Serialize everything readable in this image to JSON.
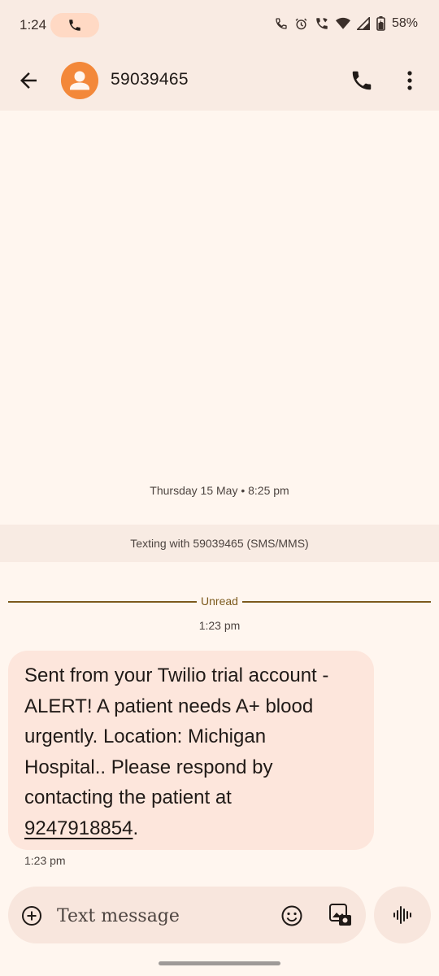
{
  "status_bar": {
    "time": "1:24",
    "battery": "58%"
  },
  "header": {
    "contact_name": "59039465"
  },
  "conversation": {
    "date_header": "Thursday 15 May • 8:25 pm",
    "texting_banner": "Texting with 59039465 (SMS/MMS)",
    "unread_label": "Unread",
    "message_time_top": "1:23 pm",
    "message": {
      "line1": "Sent from your Twilio trial account -",
      "line2": "ALERT! A patient needs A+ blood",
      "line3": "urgently. Location: Michigan",
      "line4": "Hospital.. Please respond by",
      "line5": "contacting the patient at",
      "phone_link": "9247918854",
      "trailing": "."
    },
    "message_time_bottom": "1:23 pm"
  },
  "compose": {
    "placeholder": "Text message"
  },
  "colors": {
    "background": "#fff6ef",
    "bar": "#f9ebe3",
    "bubble": "#fde6dc",
    "avatar": "#f3883a",
    "unread_accent": "#7c5a1d"
  },
  "icons": [
    "phone-icon",
    "back-arrow-icon",
    "person-icon",
    "more-vert-icon",
    "plus-circle-icon",
    "emoji-icon",
    "gallery-icon",
    "voice-wave-icon",
    "wifi-icon",
    "signal-icon",
    "battery-icon",
    "alarm-icon"
  ]
}
